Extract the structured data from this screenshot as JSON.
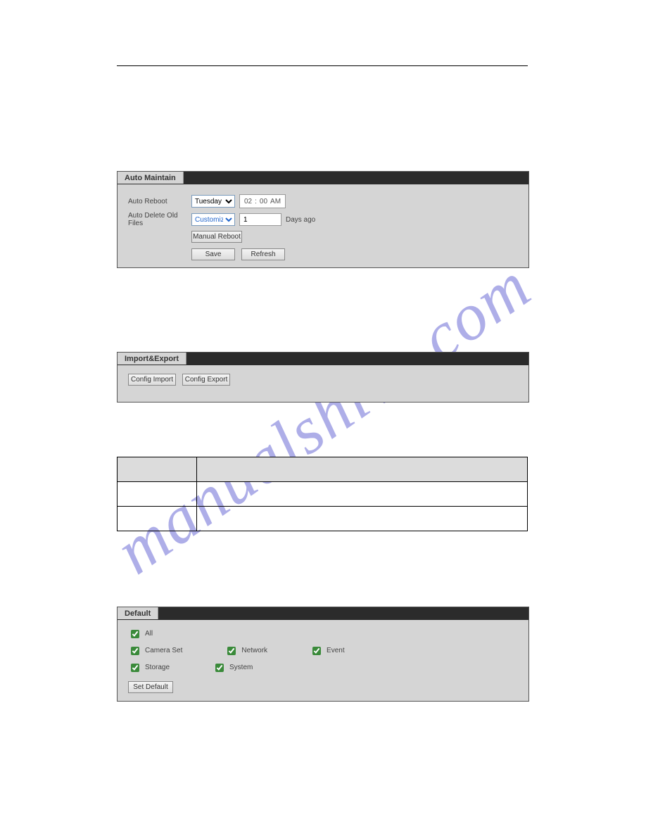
{
  "watermark": "manualshive.com",
  "autoMaintain": {
    "title": "Auto Maintain",
    "rebootLabel": "Auto Reboot",
    "deleteLabel": "Auto Delete Old Files",
    "daySelected": "Tuesday",
    "time": {
      "hh": "02",
      "mm": "00",
      "ampm": "AM"
    },
    "modeSelected": "Customized",
    "daysValue": "1",
    "daysSuffix": "Days ago",
    "manualRebootLabel": "Manual Reboot",
    "saveLabel": "Save",
    "refreshLabel": "Refresh"
  },
  "importExport": {
    "title": "Import&Export",
    "importLabel": "Config Import",
    "exportLabel": "Config Export"
  },
  "descTable": {
    "headerParam": "",
    "headerFunc": "",
    "row1Param": "",
    "row1Func": "",
    "row2Param": "",
    "row2Func": ""
  },
  "defaultPanel": {
    "title": "Default",
    "options": {
      "all": "All",
      "camera": "Camera Set",
      "network": "Network",
      "event": "Event",
      "storage": "Storage",
      "system": "System"
    },
    "setDefaultLabel": "Set Default"
  }
}
